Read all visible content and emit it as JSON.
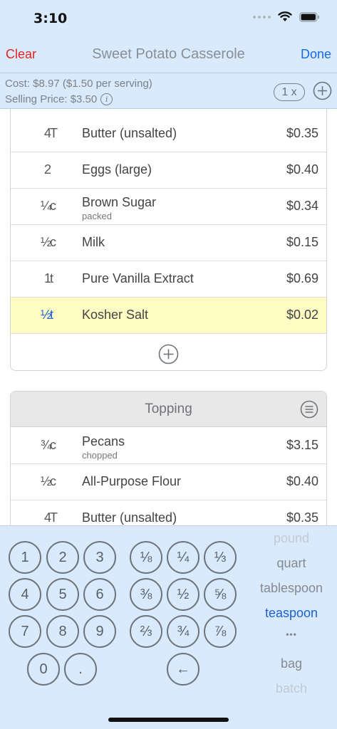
{
  "status": {
    "time": "3:10"
  },
  "nav": {
    "clear_label": "Clear",
    "title": "Sweet Potato Casserole",
    "done_label": "Done"
  },
  "cost_bar": {
    "cost_text": "Cost: $8.97 ($1.50 per serving)",
    "selling_price_text": "Selling Price: $3.50",
    "info_glyph": "i",
    "multiplier": "1 x"
  },
  "ingredients_top": [
    {
      "qty": "4",
      "unit": "T",
      "name": "Butter (unsalted)",
      "note": "",
      "price": "$0.35"
    },
    {
      "qty": "2",
      "unit": "",
      "name": "Eggs (large)",
      "note": "",
      "price": "$0.40"
    },
    {
      "qty": "¼",
      "unit": "c",
      "name": "Brown Sugar",
      "note": "packed",
      "price": "$0.34"
    },
    {
      "qty": "½",
      "unit": "c",
      "name": "Milk",
      "note": "",
      "price": "$0.15"
    },
    {
      "qty": "1",
      "unit": "t",
      "name": "Pure Vanilla Extract",
      "note": "",
      "price": "$0.69"
    },
    {
      "qty": "½",
      "unit": "t",
      "name": "Kosher Salt",
      "note": "",
      "price": "$0.02",
      "highlighted": true
    }
  ],
  "topping": {
    "title": "Topping",
    "items": [
      {
        "qty": "¾",
        "unit": "c",
        "name": "Pecans",
        "note": "chopped",
        "price": "$3.15"
      },
      {
        "qty": "½",
        "unit": "c",
        "name": "All-Purpose Flour",
        "note": "",
        "price": "$0.40"
      },
      {
        "qty": "4",
        "unit": "T",
        "name": "Butter (unsalted)",
        "note": "",
        "price": "$0.35"
      }
    ]
  },
  "keypad": {
    "digits": [
      "1",
      "2",
      "3",
      "4",
      "5",
      "6",
      "7",
      "8",
      "9",
      "0",
      "."
    ],
    "fractions": [
      "⅛",
      "¼",
      "⅓",
      "⅜",
      "½",
      "⅝",
      "⅔",
      "¾",
      "⅞"
    ],
    "backspace": "←",
    "units": [
      "pound",
      "quart",
      "tablespoon",
      "teaspoon",
      "•••",
      "bag",
      "batch"
    ],
    "selected_unit": "teaspoon"
  },
  "colors": {
    "accent": "#1a5fdc",
    "destructive": "#e0281f",
    "bar_bg": "#d9eafc",
    "highlight_row": "#fefcc3"
  }
}
